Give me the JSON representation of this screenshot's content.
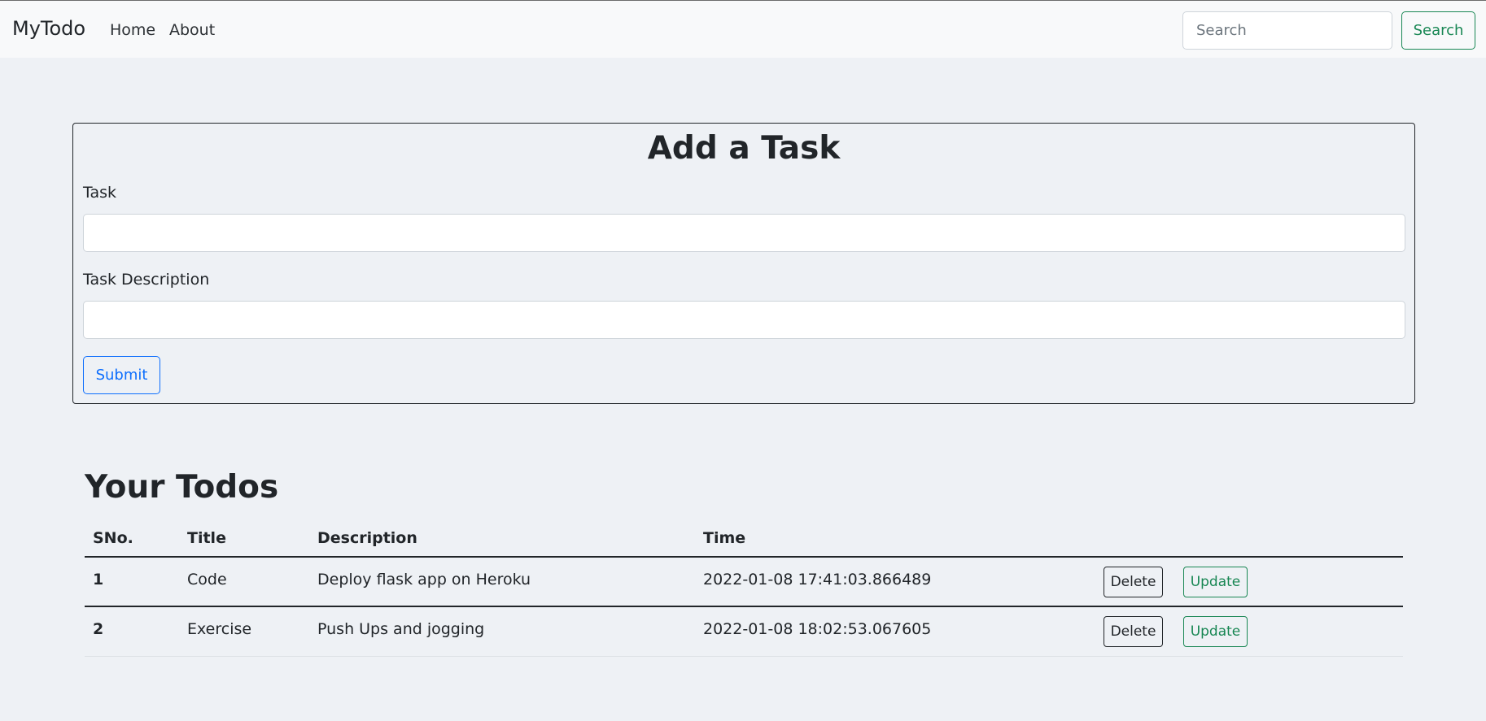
{
  "navbar": {
    "brand": "MyTodo",
    "links": [
      "Home",
      "About"
    ],
    "search_placeholder": "Search",
    "search_button": "Search"
  },
  "form": {
    "title": "Add a Task",
    "task_label": "Task",
    "task_value": "",
    "description_label": "Task Description",
    "description_value": "",
    "submit_label": "Submit"
  },
  "todos": {
    "title": "Your Todos",
    "columns": [
      "SNo.",
      "Title",
      "Description",
      "Time"
    ],
    "rows": [
      {
        "sno": "1",
        "title": "Code",
        "description": "Deploy flask app on Heroku",
        "time": "2022-01-08 17:41:03.866489",
        "delete_label": "Delete",
        "update_label": "Update"
      },
      {
        "sno": "2",
        "title": "Exercise",
        "description": "Push Ups and jogging",
        "time": "2022-01-08 18:02:53.067605",
        "delete_label": "Delete",
        "update_label": "Update"
      }
    ]
  },
  "colors": {
    "background": "#eef1f5",
    "navbar": "#f8f9fa",
    "primary": "#0d6efd",
    "success": "#198754",
    "dark": "#212529"
  }
}
